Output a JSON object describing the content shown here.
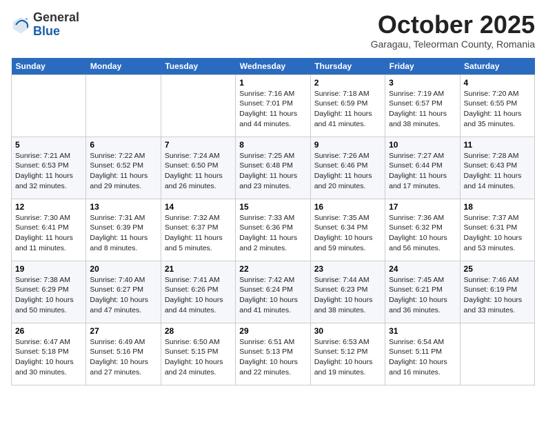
{
  "header": {
    "logo": {
      "line1": "General",
      "line2": "Blue"
    },
    "title": "October 2025",
    "subtitle": "Garagau, Teleorman County, Romania"
  },
  "weekdays": [
    "Sunday",
    "Monday",
    "Tuesday",
    "Wednesday",
    "Thursday",
    "Friday",
    "Saturday"
  ],
  "weeks": [
    [
      {
        "day": "",
        "info": ""
      },
      {
        "day": "",
        "info": ""
      },
      {
        "day": "",
        "info": ""
      },
      {
        "day": "1",
        "info": "Sunrise: 7:16 AM\nSunset: 7:01 PM\nDaylight: 11 hours and 44 minutes."
      },
      {
        "day": "2",
        "info": "Sunrise: 7:18 AM\nSunset: 6:59 PM\nDaylight: 11 hours and 41 minutes."
      },
      {
        "day": "3",
        "info": "Sunrise: 7:19 AM\nSunset: 6:57 PM\nDaylight: 11 hours and 38 minutes."
      },
      {
        "day": "4",
        "info": "Sunrise: 7:20 AM\nSunset: 6:55 PM\nDaylight: 11 hours and 35 minutes."
      }
    ],
    [
      {
        "day": "5",
        "info": "Sunrise: 7:21 AM\nSunset: 6:53 PM\nDaylight: 11 hours and 32 minutes."
      },
      {
        "day": "6",
        "info": "Sunrise: 7:22 AM\nSunset: 6:52 PM\nDaylight: 11 hours and 29 minutes."
      },
      {
        "day": "7",
        "info": "Sunrise: 7:24 AM\nSunset: 6:50 PM\nDaylight: 11 hours and 26 minutes."
      },
      {
        "day": "8",
        "info": "Sunrise: 7:25 AM\nSunset: 6:48 PM\nDaylight: 11 hours and 23 minutes."
      },
      {
        "day": "9",
        "info": "Sunrise: 7:26 AM\nSunset: 6:46 PM\nDaylight: 11 hours and 20 minutes."
      },
      {
        "day": "10",
        "info": "Sunrise: 7:27 AM\nSunset: 6:44 PM\nDaylight: 11 hours and 17 minutes."
      },
      {
        "day": "11",
        "info": "Sunrise: 7:28 AM\nSunset: 6:43 PM\nDaylight: 11 hours and 14 minutes."
      }
    ],
    [
      {
        "day": "12",
        "info": "Sunrise: 7:30 AM\nSunset: 6:41 PM\nDaylight: 11 hours and 11 minutes."
      },
      {
        "day": "13",
        "info": "Sunrise: 7:31 AM\nSunset: 6:39 PM\nDaylight: 11 hours and 8 minutes."
      },
      {
        "day": "14",
        "info": "Sunrise: 7:32 AM\nSunset: 6:37 PM\nDaylight: 11 hours and 5 minutes."
      },
      {
        "day": "15",
        "info": "Sunrise: 7:33 AM\nSunset: 6:36 PM\nDaylight: 11 hours and 2 minutes."
      },
      {
        "day": "16",
        "info": "Sunrise: 7:35 AM\nSunset: 6:34 PM\nDaylight: 10 hours and 59 minutes."
      },
      {
        "day": "17",
        "info": "Sunrise: 7:36 AM\nSunset: 6:32 PM\nDaylight: 10 hours and 56 minutes."
      },
      {
        "day": "18",
        "info": "Sunrise: 7:37 AM\nSunset: 6:31 PM\nDaylight: 10 hours and 53 minutes."
      }
    ],
    [
      {
        "day": "19",
        "info": "Sunrise: 7:38 AM\nSunset: 6:29 PM\nDaylight: 10 hours and 50 minutes."
      },
      {
        "day": "20",
        "info": "Sunrise: 7:40 AM\nSunset: 6:27 PM\nDaylight: 10 hours and 47 minutes."
      },
      {
        "day": "21",
        "info": "Sunrise: 7:41 AM\nSunset: 6:26 PM\nDaylight: 10 hours and 44 minutes."
      },
      {
        "day": "22",
        "info": "Sunrise: 7:42 AM\nSunset: 6:24 PM\nDaylight: 10 hours and 41 minutes."
      },
      {
        "day": "23",
        "info": "Sunrise: 7:44 AM\nSunset: 6:23 PM\nDaylight: 10 hours and 38 minutes."
      },
      {
        "day": "24",
        "info": "Sunrise: 7:45 AM\nSunset: 6:21 PM\nDaylight: 10 hours and 36 minutes."
      },
      {
        "day": "25",
        "info": "Sunrise: 7:46 AM\nSunset: 6:19 PM\nDaylight: 10 hours and 33 minutes."
      }
    ],
    [
      {
        "day": "26",
        "info": "Sunrise: 6:47 AM\nSunset: 5:18 PM\nDaylight: 10 hours and 30 minutes."
      },
      {
        "day": "27",
        "info": "Sunrise: 6:49 AM\nSunset: 5:16 PM\nDaylight: 10 hours and 27 minutes."
      },
      {
        "day": "28",
        "info": "Sunrise: 6:50 AM\nSunset: 5:15 PM\nDaylight: 10 hours and 24 minutes."
      },
      {
        "day": "29",
        "info": "Sunrise: 6:51 AM\nSunset: 5:13 PM\nDaylight: 10 hours and 22 minutes."
      },
      {
        "day": "30",
        "info": "Sunrise: 6:53 AM\nSunset: 5:12 PM\nDaylight: 10 hours and 19 minutes."
      },
      {
        "day": "31",
        "info": "Sunrise: 6:54 AM\nSunset: 5:11 PM\nDaylight: 10 hours and 16 minutes."
      },
      {
        "day": "",
        "info": ""
      }
    ]
  ]
}
